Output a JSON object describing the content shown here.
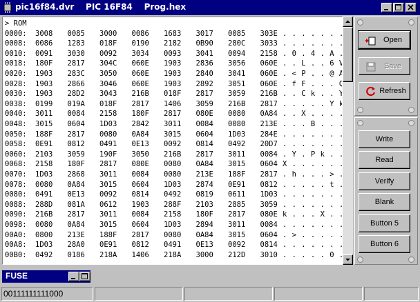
{
  "window": {
    "title": "pic16f84.dvr    PIC 16F84    Prog.hex"
  },
  "dump": {
    "header": "> ROM",
    "rows": [
      {
        "addr": "0000:",
        "words": [
          "3008",
          "0085",
          "3000",
          "0086",
          "1683",
          "3017",
          "0085",
          "303E"
        ],
        "ascii": ". . . . . . . ."
      },
      {
        "addr": "0008:",
        "words": [
          "0086",
          "1283",
          "018F",
          "0190",
          "2182",
          "0B90",
          "280C",
          "3033"
        ],
        "ascii": ". . . . . . . ."
      },
      {
        "addr": "0010:",
        "words": [
          "0091",
          "3030",
          "0092",
          "3034",
          "0093",
          "3041",
          "0094",
          "2158"
        ],
        "ascii": ". 0 . 4 . A . ."
      },
      {
        "addr": "0018:",
        "words": [
          "180F",
          "2817",
          "304C",
          "060E",
          "1903",
          "2836",
          "3056",
          "060E"
        ],
        "ascii": ". . L . . 6 V ."
      },
      {
        "addr": "0020:",
        "words": [
          "1903",
          "283C",
          "3050",
          "060E",
          "1903",
          "2840",
          "3041",
          "060E"
        ],
        "ascii": ". < P . . @ A ."
      },
      {
        "addr": "0028:",
        "words": [
          "1903",
          "2866",
          "3046",
          "060E",
          "1903",
          "2892",
          "3051",
          "060E"
        ],
        "ascii": ". f F . . . Q ."
      },
      {
        "addr": "0030:",
        "words": [
          "1903",
          "28D2",
          "3043",
          "216B",
          "018F",
          "2817",
          "3059",
          "216B"
        ],
        "ascii": ". . C k . . Y k"
      },
      {
        "addr": "0038:",
        "words": [
          "0199",
          "019A",
          "018F",
          "2817",
          "1406",
          "3059",
          "216B",
          "2817"
        ],
        "ascii": ". . . . . Y k ."
      },
      {
        "addr": "0040:",
        "words": [
          "3011",
          "0084",
          "2158",
          "180F",
          "2817",
          "080E",
          "0080",
          "0A84"
        ],
        "ascii": ". . X . . . . ."
      },
      {
        "addr": "0048:",
        "words": [
          "3015",
          "0604",
          "1D03",
          "2842",
          "3011",
          "0084",
          "0080",
          "213E"
        ],
        "ascii": ". . . B . . . >"
      },
      {
        "addr": "0050:",
        "words": [
          "188F",
          "2817",
          "0080",
          "0A84",
          "3015",
          "0604",
          "1D03",
          "284E"
        ],
        "ascii": ". . . . . . . N"
      },
      {
        "addr": "0058:",
        "words": [
          "0E91",
          "0812",
          "0491",
          "0E13",
          "0092",
          "0814",
          "0492",
          "20D7"
        ],
        "ascii": ". . . . . . . ."
      },
      {
        "addr": "0060:",
        "words": [
          "2103",
          "3059",
          "190F",
          "3050",
          "216B",
          "2817",
          "3011",
          "0084"
        ],
        "ascii": ". Y . P k . . ."
      },
      {
        "addr": "0068:",
        "words": [
          "2158",
          "180F",
          "2817",
          "080E",
          "0080",
          "0A84",
          "3015",
          "0604"
        ],
        "ascii": "X . . . . . . ."
      },
      {
        "addr": "0070:",
        "words": [
          "1D03",
          "2868",
          "3011",
          "0084",
          "0080",
          "213E",
          "188F",
          "2817"
        ],
        "ascii": ". h . . . > . ."
      },
      {
        "addr": "0078:",
        "words": [
          "0080",
          "0A84",
          "3015",
          "0604",
          "1D03",
          "2874",
          "0E91",
          "0812"
        ],
        "ascii": ". . . . . t . ."
      },
      {
        "addr": "0080:",
        "words": [
          "0491",
          "0E13",
          "0092",
          "0814",
          "0492",
          "0819",
          "0611",
          "1D03"
        ],
        "ascii": ". . . . . . . ."
      },
      {
        "addr": "0088:",
        "words": [
          "288D",
          "081A",
          "0612",
          "1903",
          "288F",
          "2103",
          "2885",
          "3059"
        ],
        "ascii": ". . . . . . . Y"
      },
      {
        "addr": "0090:",
        "words": [
          "216B",
          "2817",
          "3011",
          "0084",
          "2158",
          "180F",
          "2817",
          "080E"
        ],
        "ascii": "k . . . X . . ."
      },
      {
        "addr": "0098:",
        "words": [
          "0080",
          "0A84",
          "3015",
          "0604",
          "1D03",
          "2894",
          "3011",
          "0084"
        ],
        "ascii": ". . . . . . . ."
      },
      {
        "addr": "00A0:",
        "words": [
          "0800",
          "213E",
          "188F",
          "2817",
          "0080",
          "0A84",
          "3015",
          "0604"
        ],
        "ascii": ". > . . . . . ."
      },
      {
        "addr": "00A8:",
        "words": [
          "1D03",
          "28A0",
          "0E91",
          "0812",
          "0491",
          "0E13",
          "0092",
          "0814"
        ],
        "ascii": ". . . . . . . ."
      },
      {
        "addr": "00B0:",
        "words": [
          "0492",
          "0186",
          "218A",
          "1406",
          "218A",
          "3000",
          "212D",
          "3010"
        ],
        "ascii": ". . . . . 0 . ."
      }
    ]
  },
  "buttons": {
    "open": "Open",
    "save": "Save",
    "refresh": "Refresh",
    "write": "Write",
    "read": "Read",
    "verify": "Verify",
    "blank": "Blank",
    "button5": "Button 5",
    "button6": "Button 6"
  },
  "fuse_window": {
    "title": "FUSE"
  },
  "status": {
    "fuse_bits": "00111111111000"
  },
  "icons": {
    "app": "chip-icon",
    "open": "open-folder-icon",
    "save": "floppy-icon",
    "refresh": "refresh-icon"
  },
  "colors": {
    "titlebar": "#000080",
    "face": "#c0c0c0",
    "refresh_red": "#d00000"
  }
}
